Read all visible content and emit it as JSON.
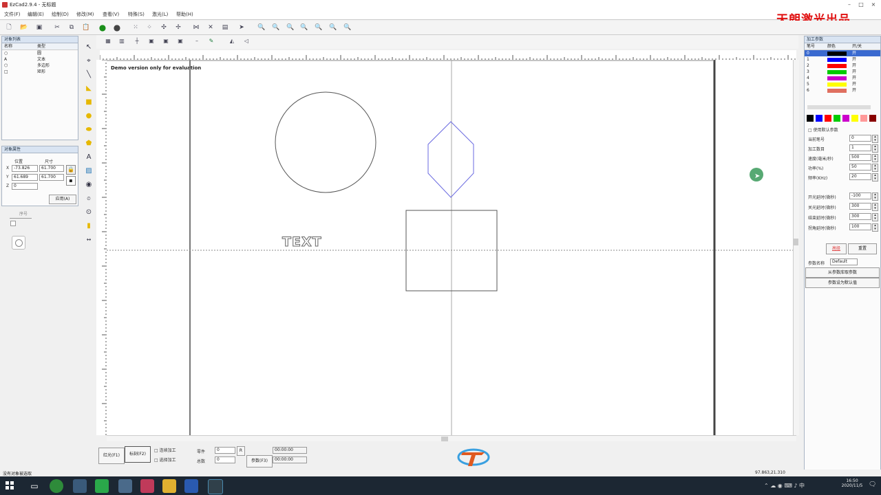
{
  "window": {
    "title": "EzCad2.9.4 - 无标题"
  },
  "brand": "天朗激光出品",
  "menu": [
    "文件(F)",
    "编辑(E)",
    "绘制(D)",
    "修改(M)",
    "查看(V)",
    "特殊(S)",
    "激光(L)",
    "帮助(H)"
  ],
  "object_list": {
    "title": "对象列表",
    "headers": [
      "名称",
      "类型"
    ],
    "rows": [
      {
        "icon": "○",
        "type": "圆"
      },
      {
        "icon": "A",
        "type": "文本"
      },
      {
        "icon": "⬡",
        "type": "多边形"
      },
      {
        "icon": "□",
        "type": "矩形"
      }
    ]
  },
  "object_props": {
    "title": "对象属性",
    "pos_label": "位置",
    "size_label": "尺寸",
    "x_pos": "-73.826",
    "x_size": "61.700",
    "y_pos": "61.689",
    "y_size": "61.700",
    "z_val": "0",
    "apply_label": "应用(A)",
    "fill_label": "序号"
  },
  "canvas": {
    "demo_text": "Demo version only for evaluation",
    "text_object": "TEXT"
  },
  "bottom": {
    "red_btn": "红光(F1)",
    "mark_btn": "标刻(F2)",
    "continuous_label": "□ 连续加工",
    "parts_label": "零件",
    "parts_val": "0",
    "selected_label": "□ 选择加工",
    "total_label": "总数",
    "total_val": "0",
    "r_btn": "R",
    "param_btn": "参数(F3)",
    "time1": "00:00:00",
    "time2": "00:00:00"
  },
  "right_panel": {
    "title": "加工参数",
    "pen_headers": [
      "笔号",
      "颜色",
      "开/关"
    ],
    "pens": [
      {
        "no": "0",
        "color": "#000000",
        "on": "开"
      },
      {
        "no": "1",
        "color": "#0000ff",
        "on": "开"
      },
      {
        "no": "2",
        "color": "#ff0000",
        "on": "开"
      },
      {
        "no": "3",
        "color": "#00cc00",
        "on": "开"
      },
      {
        "no": "4",
        "color": "#cc00cc",
        "on": "开"
      },
      {
        "no": "5",
        "color": "#ffff00",
        "on": "开"
      },
      {
        "no": "6",
        "color": "#e07060",
        "on": "开"
      }
    ],
    "palette": [
      "#000000",
      "#0000ff",
      "#ff0000",
      "#00cc00",
      "#cc00cc",
      "#ffff00",
      "#ff9999",
      "#880000"
    ],
    "use_default": "使用默认参数",
    "fields": [
      {
        "label": "当前笔号",
        "value": "0"
      },
      {
        "label": "加工数目",
        "value": "1"
      },
      {
        "label": "速度(毫米/秒)",
        "value": "500"
      },
      {
        "label": "功率(%)",
        "value": "50"
      },
      {
        "label": "频率(KHz)",
        "value": "20"
      }
    ],
    "delays": [
      {
        "label": "开光延时(微秒)",
        "value": "-100"
      },
      {
        "label": "关光延时(微秒)",
        "value": "300"
      },
      {
        "label": "结束延时(微秒)",
        "value": "300"
      },
      {
        "label": "拐角延时(微秒)",
        "value": "100"
      }
    ],
    "advanced_btn": "高级",
    "param_name_label": "参数名称",
    "param_name_val": "Default",
    "load_btn": "从参数库取参数",
    "save_btn": "参数设为默认值"
  },
  "status": {
    "left": "没有对象被选取",
    "coords": "97.863,21.310"
  },
  "taskbar": {
    "time": "16:50",
    "date": "2020/11/5"
  }
}
